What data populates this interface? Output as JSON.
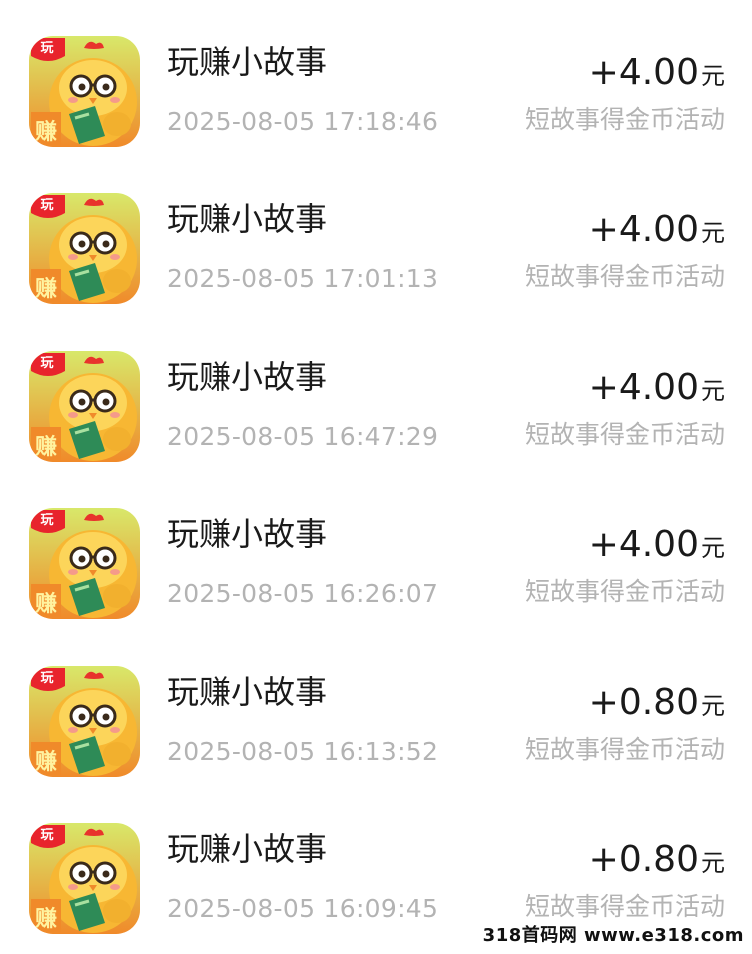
{
  "transactions": [
    {
      "app_name": "玩赚小故事",
      "timestamp": "2025-08-05 17:18:46",
      "amount": "+4.00",
      "unit": "元",
      "description": "短故事得金币活动"
    },
    {
      "app_name": "玩赚小故事",
      "timestamp": "2025-08-05 17:01:13",
      "amount": "+4.00",
      "unit": "元",
      "description": "短故事得金币活动"
    },
    {
      "app_name": "玩赚小故事",
      "timestamp": "2025-08-05 16:47:29",
      "amount": "+4.00",
      "unit": "元",
      "description": "短故事得金币活动"
    },
    {
      "app_name": "玩赚小故事",
      "timestamp": "2025-08-05 16:26:07",
      "amount": "+4.00",
      "unit": "元",
      "description": "短故事得金币活动"
    },
    {
      "app_name": "玩赚小故事",
      "timestamp": "2025-08-05 16:13:52",
      "amount": "+0.80",
      "unit": "元",
      "description": "短故事得金币活动"
    },
    {
      "app_name": "玩赚小故事",
      "timestamp": "2025-08-05 16:09:45",
      "amount": "+0.80",
      "unit": "元",
      "description": "短故事得金币活动"
    }
  ],
  "app_icon": {
    "icon": "chick-reading-book-icon",
    "badge_top": "玩",
    "badge_bottom": "赚",
    "colors": {
      "badge": "#e8242c",
      "body": "#f7b733",
      "book": "#2e8b57",
      "background_top": "#d8e86a",
      "background_bottom": "#f08a2a"
    }
  },
  "watermark": "318首码网 www.e318.com"
}
